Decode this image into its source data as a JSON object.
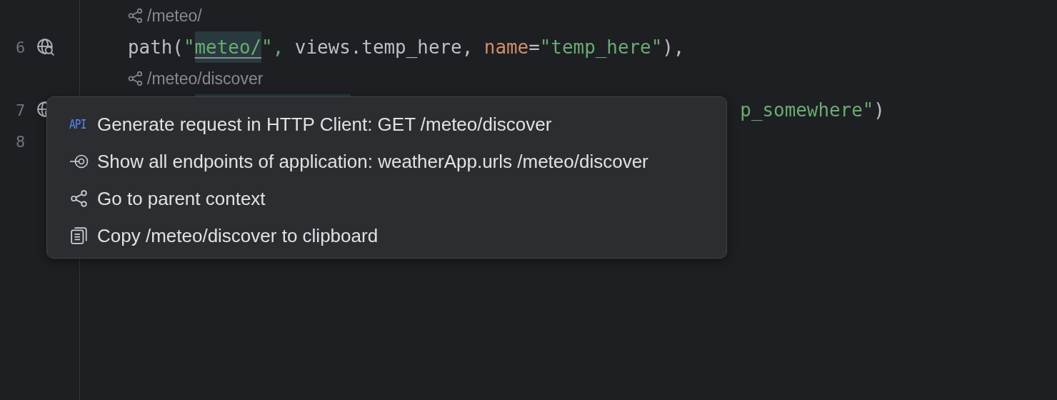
{
  "editor": {
    "lines": [
      {
        "kind": "hint",
        "text": "/meteo/"
      },
      {
        "kind": "code",
        "number": "6",
        "endpoint_marker": true,
        "selection": false,
        "tokens": [
          {
            "kind": "plain",
            "text": "path(",
            "highlighted": false
          },
          {
            "kind": "string",
            "text": "\"",
            "highlighted": false
          },
          {
            "kind": "string",
            "text": "meteo/",
            "highlighted": true
          },
          {
            "kind": "string",
            "text": "\", ",
            "highlighted": false
          },
          {
            "kind": "plain",
            "text": "views.temp_here, ",
            "highlighted": false
          },
          {
            "kind": "param",
            "text": "name",
            "highlighted": false
          },
          {
            "kind": "plain",
            "text": "=",
            "highlighted": false
          },
          {
            "kind": "string",
            "text": "\"temp_here\"",
            "highlighted": false
          },
          {
            "kind": "plain",
            "text": "),",
            "highlighted": false
          }
        ]
      },
      {
        "kind": "hint",
        "text": "/meteo/discover"
      },
      {
        "kind": "code",
        "number": "7",
        "endpoint_marker": true,
        "selection": true,
        "tail": [
          {
            "kind": "string",
            "text": "p_somewhere\"",
            "highlighted": false
          },
          {
            "kind": "plain",
            "text": ")",
            "highlighted": false
          }
        ]
      },
      {
        "kind": "code",
        "number": "8",
        "endpoint_marker": false,
        "selection": false
      }
    ]
  },
  "popup": {
    "items": [
      {
        "kind": "api",
        "icon_text": "API",
        "label": "Generate request in HTTP Client: GET /meteo/discover"
      },
      {
        "kind": "endpoints",
        "label": "Show all endpoints of application: weatherApp.urls /meteo/discover"
      },
      {
        "kind": "share",
        "label": "Go to parent context"
      },
      {
        "kind": "copy",
        "label": "Copy /meteo/discover to clipboard"
      }
    ]
  }
}
